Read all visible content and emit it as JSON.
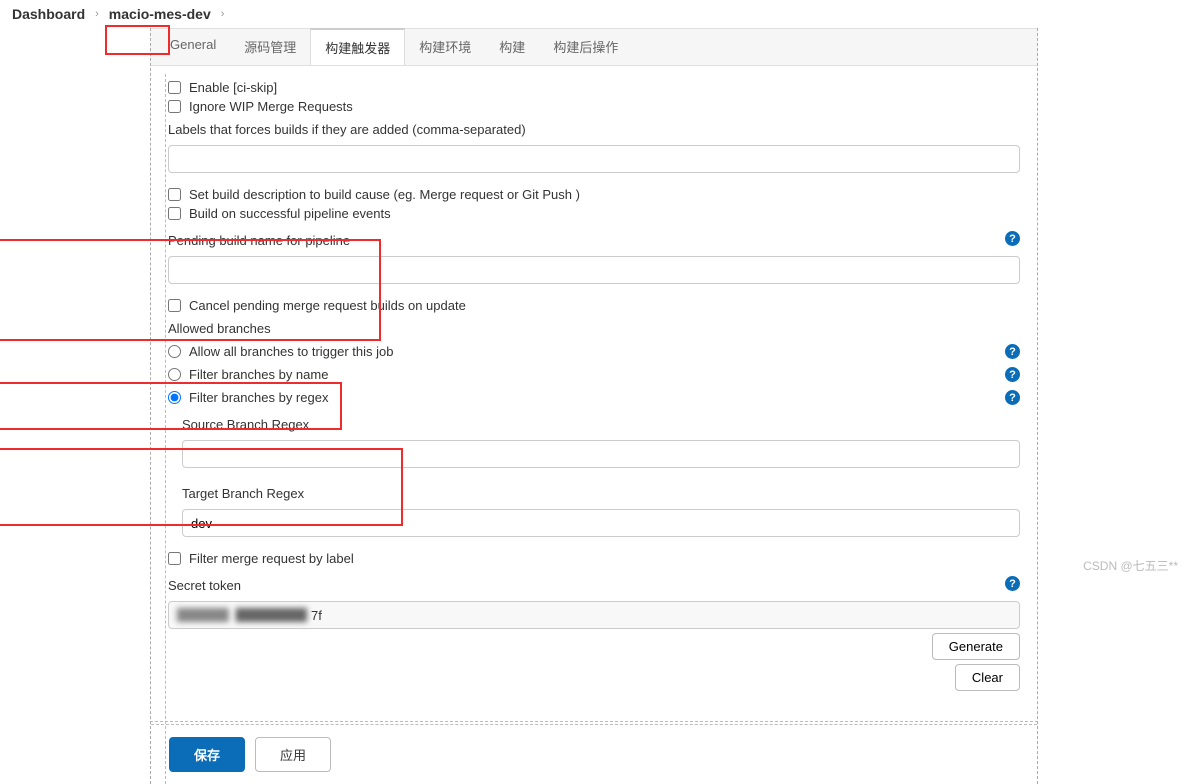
{
  "breadcrumb": {
    "dashboard": "Dashboard",
    "project": "macio-mes-dev"
  },
  "tabs": {
    "general": "General",
    "scm": "源码管理",
    "triggers": "构建触发器",
    "env": "构建环境",
    "build": "构建",
    "post": "构建后操作"
  },
  "rows": {
    "enable_ci_skip": "Enable [ci-skip]",
    "ignore_wip": "Ignore WIP Merge Requests",
    "labels_force": "Labels that forces builds if they are added (comma-separated)",
    "set_desc": "Set build description to build cause (eg. Merge request or Git Push )",
    "build_on_pipeline": "Build on successful pipeline events",
    "pending_name": "Pending build name for pipeline",
    "cancel_pending": "Cancel pending merge request builds on update",
    "allowed_branches": "Allowed branches",
    "allow_all": "Allow all branches to trigger this job",
    "filter_name": "Filter branches by name",
    "filter_regex": "Filter branches by regex",
    "source_regex": "Source Branch Regex",
    "target_regex": "Target Branch Regex",
    "target_value": "dev",
    "filter_mr_label": "Filter merge request by label",
    "secret_token": "Secret token",
    "token_suffix": "7f"
  },
  "buttons": {
    "generate": "Generate",
    "clear": "Clear",
    "save": "保存",
    "apply": "应用"
  },
  "watermark": "CSDN @七五三**"
}
